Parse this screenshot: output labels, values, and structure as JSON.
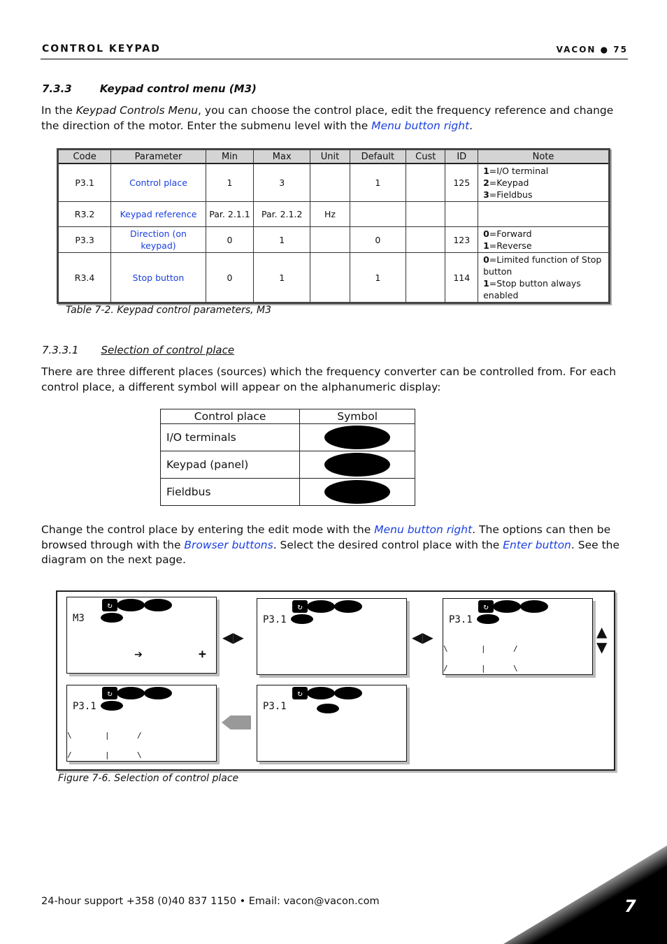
{
  "header": {
    "left": "CONTROL KEYPAD",
    "right": "VACON ● 75"
  },
  "section": {
    "number": "7.3.3",
    "title": "Keypad control menu (M3)"
  },
  "intro": {
    "t1": "In the ",
    "i1": "Keypad Controls Menu",
    "t2": ", you can choose the control place, edit the frequency reference and change the direction of the motor. Enter the submenu level with the ",
    "link": "Menu button right",
    "t3": "."
  },
  "param_table": {
    "headers": [
      "Code",
      "Parameter",
      "Min",
      "Max",
      "Unit",
      "Default",
      "Cust",
      "ID",
      "Note"
    ],
    "rows": [
      {
        "code": "P3.1",
        "param": "Control place",
        "min": "1",
        "max": "3",
        "unit": "",
        "default": "1",
        "cust": "",
        "id": "125",
        "note": [
          [
            "1",
            "=I/O terminal"
          ],
          [
            "2",
            "=Keypad"
          ],
          [
            "3",
            "=Fieldbus"
          ]
        ]
      },
      {
        "code": "R3.2",
        "param": "Keypad reference",
        "min": "Par. 2.1.1",
        "max": "Par. 2.1.2",
        "unit": "Hz",
        "default": "",
        "cust": "",
        "id": "",
        "note": []
      },
      {
        "code": "P3.3",
        "param": "Direction (on keypad)",
        "min": "0",
        "max": "1",
        "unit": "",
        "default": "0",
        "cust": "",
        "id": "123",
        "note": [
          [
            "0",
            "=Forward"
          ],
          [
            "1",
            "=Reverse"
          ]
        ]
      },
      {
        "code": "R3.4",
        "param": "Stop button",
        "min": "0",
        "max": "1",
        "unit": "",
        "default": "1",
        "cust": "",
        "id": "114",
        "note": [
          [
            "0",
            "=Limited function of Stop button"
          ],
          [
            "1",
            "=Stop button always enabled"
          ]
        ]
      }
    ],
    "caption": "Table 7-2. Keypad control parameters, M3"
  },
  "subsection": {
    "number": "7.3.3.1",
    "title": "Selection of control place"
  },
  "para2": "There are three different places (sources) which the frequency converter can be controlled from. For each control place, a different symbol will appear on the alphanumeric display:",
  "symbol_table": {
    "headers": [
      "Control place",
      "Symbol"
    ],
    "rows": [
      "I/O terminals",
      "Keypad (panel)",
      "Fieldbus"
    ]
  },
  "para3": {
    "t1": "Change the control place by entering the edit mode with the ",
    "l1": "Menu button right",
    "t2": ". The options can then be browsed through with the ",
    "l2": "Browser buttons",
    "t3": ". Select the desired control place with the ",
    "l3": "Enter button",
    "t4": ". See the diagram on the next page."
  },
  "figure": {
    "panels": [
      "M3",
      "P3.1",
      "P3.1",
      "P3.1",
      "P3.1"
    ],
    "caption": "Figure 7-6. Selection of control place"
  },
  "footer": {
    "support": "24-hour support +358 (0)40 837 1150 • Email: vacon@vacon.com",
    "chapter": "7"
  }
}
